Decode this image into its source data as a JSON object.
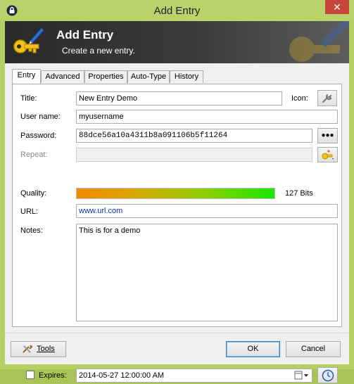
{
  "window": {
    "title": "Add Entry"
  },
  "banner": {
    "title": "Add Entry",
    "subtitle": "Create a new entry."
  },
  "tabs": [
    {
      "label": "Entry",
      "active": true
    },
    {
      "label": "Advanced"
    },
    {
      "label": "Properties"
    },
    {
      "label": "Auto-Type"
    },
    {
      "label": "History"
    }
  ],
  "form": {
    "title_label": "Title:",
    "title_value": "New Entry Demo",
    "icon_label": "Icon:",
    "username_label": "User name:",
    "username_value": "myusername",
    "password_label": "Password:",
    "password_value": "88dce56a10a4311b8a091106b5f11264",
    "show_password_label": "●●●",
    "repeat_label": "Repeat:",
    "repeat_value": "",
    "quality_label": "Quality:",
    "quality_fraction": 1.0,
    "quality_bits": "127 Bits",
    "url_label": "URL:",
    "url_value": "www.url.com",
    "notes_label": "Notes:",
    "notes_value": "This is for a demo",
    "expires_label": "Expires:",
    "expires_checked": false,
    "expires_value": "2014-05-27 12:00:00 AM"
  },
  "buttons": {
    "tools": "Tools",
    "ok": "OK",
    "cancel": "Cancel"
  },
  "icons": [
    "keepass-lock-icon",
    "close-icon",
    "key-icon",
    "wrench-icon",
    "generate-password-icon",
    "calendar-dropdown-icon",
    "clock-icon",
    "tools-icon"
  ]
}
